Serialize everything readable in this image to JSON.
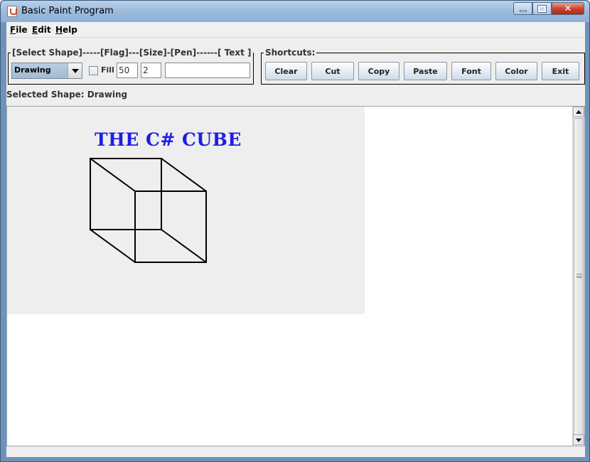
{
  "window": {
    "title": "Basic Paint Program",
    "controls": {
      "minimize": "minimize",
      "maximize": "maximize",
      "close": "✕"
    }
  },
  "menu": [
    "File",
    "Edit",
    "Help"
  ],
  "tools": {
    "legend": "[Select Shape]-----[Flag]---[Size]-[Pen]------[   Text   ]",
    "shape_selected": "Drawing",
    "fill_label": "Fill",
    "fill_checked": false,
    "size_value": "50",
    "pen_value": "2",
    "text_value": ""
  },
  "shortcuts": {
    "legend": "Shortcuts:",
    "buttons": [
      "Clear",
      "Cut",
      "Copy",
      "Paste",
      "Font",
      "Color",
      "Exit"
    ]
  },
  "status": {
    "selected_shape": "Selected Shape: Drawing"
  },
  "canvas": {
    "text": "THE C# CUBE",
    "text_color": "#1d1de8",
    "stroke_color": "#000000"
  },
  "icons": [
    "java-app-icon",
    "combo-arrow-icon",
    "scroll-up-icon",
    "scroll-down-icon",
    "scroll-grip-icon"
  ]
}
